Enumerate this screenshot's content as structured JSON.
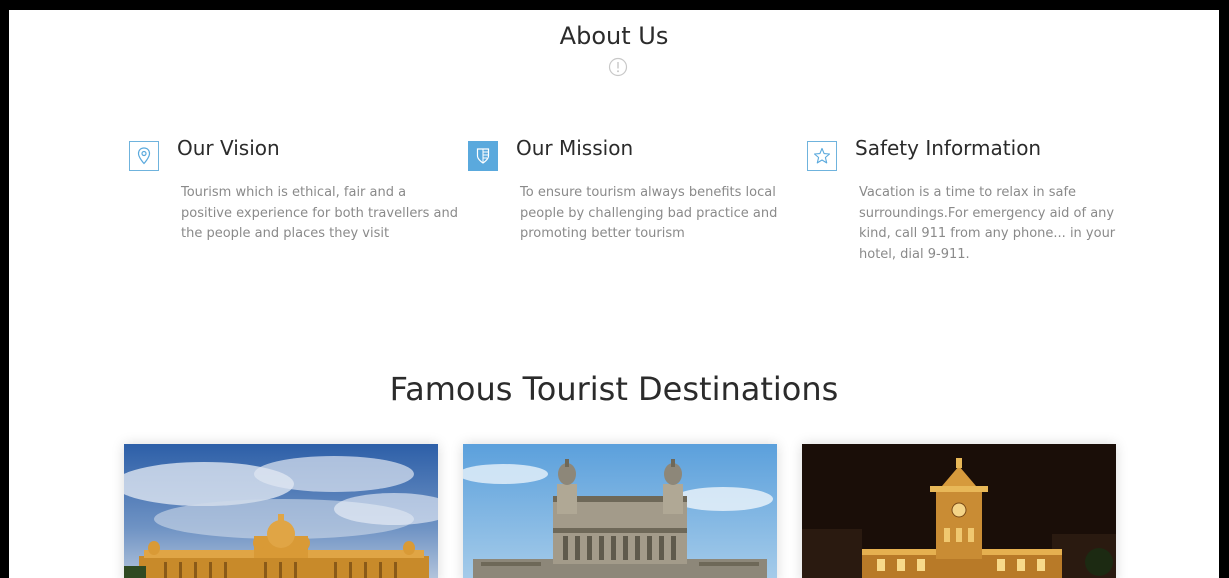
{
  "about": {
    "title": "About Us"
  },
  "features": [
    {
      "title": "Our Vision",
      "icon": "map-pin-icon",
      "text": "Tourism which is ethical, fair and a positive experience for both travellers and the people and places they visit"
    },
    {
      "title": "Our Mission",
      "icon": "shield-icon",
      "text": "To ensure tourism always benefits local people by challenging bad practice and promoting better tourism"
    },
    {
      "title": "Safety Information",
      "icon": "star-icon",
      "text": "Vacation is a time to relax in safe surroundings.For emergency aid of any kind, call 911 from any phone... in your hotel, dial 9-911."
    }
  ],
  "destinations": {
    "title": "Famous Tourist Destinations"
  },
  "colors": {
    "accent": "#5aa9dd",
    "heading": "#2b2b2b",
    "body_text": "#8a8a8a"
  }
}
